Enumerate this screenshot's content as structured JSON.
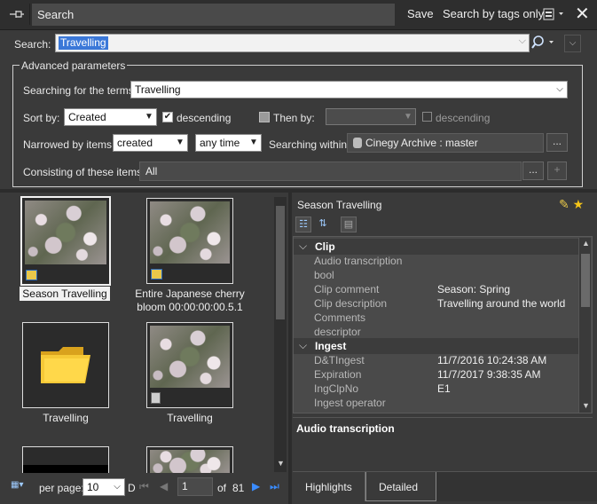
{
  "window": {
    "title": "Search",
    "save_label": "Save",
    "search_by_tags_label": "Search by tags only"
  },
  "search": {
    "label": "Search:",
    "value": "Travelling"
  },
  "advanced": {
    "title": "Advanced parameters",
    "terms_label": "Searching for the terms:",
    "terms_value": "Travelling",
    "sort_label": "Sort by:",
    "sort_value": "Created",
    "descending_label": "descending",
    "then_by_label": "Then by:",
    "then_by_value": "",
    "then_descending_label": "descending",
    "narrowed_label": "Narrowed by items:",
    "narrowed_value": "created",
    "time_value": "any time",
    "within_label": "Searching within:",
    "within_value": "Cinegy Archive : master",
    "consisting_label": "Consisting of these items:",
    "consisting_value": "All",
    "ellipsis": "...",
    "plus": "+"
  },
  "thumbnails": [
    {
      "caption": "Season Travelling",
      "selected": true
    },
    {
      "caption": "Entire Japanese cherry bloom 00:00:00:00.5.1",
      "selected": false
    },
    {
      "caption": "Travelling",
      "selected": false
    },
    {
      "caption": "Travelling",
      "selected": false
    }
  ],
  "nav": {
    "per_page_label": "per page:",
    "per_page_value": "10",
    "d_label": "D",
    "page_value": "1",
    "of_label": "of",
    "total_pages": "81"
  },
  "details": {
    "title": "Season Travelling",
    "groups": [
      {
        "name": "Clip",
        "rows": [
          {
            "name": "Audio transcription",
            "value": ""
          },
          {
            "name": "bool",
            "value": ""
          },
          {
            "name": "Clip comment",
            "value": "Season: Spring"
          },
          {
            "name": "Clip description",
            "value": "Travelling around the world"
          },
          {
            "name": "Comments",
            "value": ""
          },
          {
            "name": "descriptor",
            "value": ""
          }
        ]
      },
      {
        "name": "Ingest",
        "rows": [
          {
            "name": "D&TIngest",
            "value": "11/7/2016 10:24:38 AM"
          },
          {
            "name": "Expiration",
            "value": "11/7/2017 9:38:35 AM"
          },
          {
            "name": "IngClpNo",
            "value": "E1"
          },
          {
            "name": "Ingest operator",
            "value": ""
          }
        ]
      }
    ],
    "description_title": "Audio transcription"
  },
  "tabs": {
    "highlights": "Highlights",
    "detailed": "Detailed"
  }
}
